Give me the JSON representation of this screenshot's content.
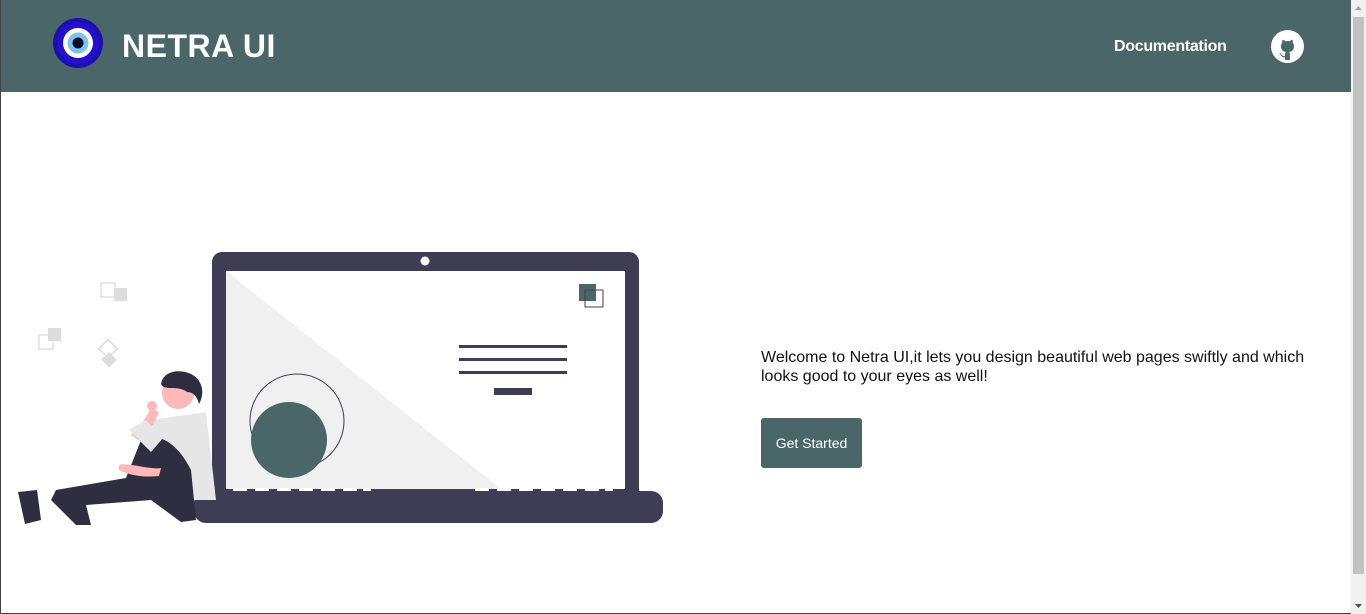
{
  "brand": {
    "title": "NETRA UI",
    "logo_icon": "evil-eye-icon"
  },
  "nav": {
    "documentation_label": "Documentation",
    "github_icon": "github-icon"
  },
  "hero": {
    "description": "Welcome to Netra UI,it lets you design beautiful web pages swiftly and which looks good to your eyes as well!",
    "cta_label": "Get Started",
    "illustration": "person-leaning-on-laptop-illustration"
  },
  "colors": {
    "primary": "#4a6669",
    "laptop_dark": "#3f3d56",
    "background": "#ffffff"
  }
}
